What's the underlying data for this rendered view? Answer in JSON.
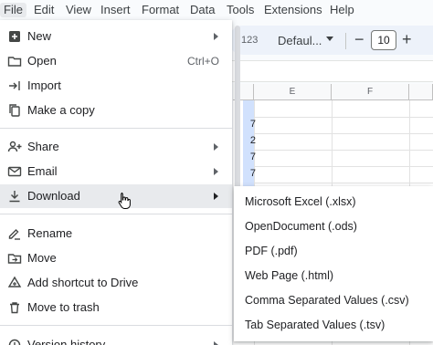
{
  "menubar": {
    "items": [
      "File",
      "Edit",
      "View",
      "Insert",
      "Format",
      "Data",
      "Tools",
      "Extensions",
      "Help"
    ]
  },
  "toolbar": {
    "number_format": "123",
    "font": "Defaul...",
    "minus": "−",
    "font_size": "10",
    "plus": "+"
  },
  "grid": {
    "columns": [
      "E",
      "F"
    ],
    "partial_values": [
      "7",
      "2",
      "7",
      "7"
    ]
  },
  "file_menu": {
    "items": [
      {
        "label": "New",
        "icon": "new-icon",
        "submenu": true
      },
      {
        "label": "Open",
        "icon": "folder-icon",
        "shortcut": "Ctrl+O"
      },
      {
        "label": "Import",
        "icon": "import-icon"
      },
      {
        "label": "Make a copy",
        "icon": "copy-icon"
      },
      {
        "label": "Share",
        "icon": "share-icon",
        "submenu": true
      },
      {
        "label": "Email",
        "icon": "email-icon",
        "submenu": true
      },
      {
        "label": "Download",
        "icon": "download-icon",
        "submenu": true
      },
      {
        "label": "Rename",
        "icon": "rename-icon"
      },
      {
        "label": "Move",
        "icon": "move-icon"
      },
      {
        "label": "Add shortcut to Drive",
        "icon": "drive-shortcut-icon"
      },
      {
        "label": "Move to trash",
        "icon": "trash-icon"
      },
      {
        "label": "Version history",
        "icon": "history-icon",
        "submenu": true
      }
    ]
  },
  "download_submenu": {
    "items": [
      "Microsoft Excel (.xlsx)",
      "OpenDocument (.ods)",
      "PDF (.pdf)",
      "Web Page (.html)",
      "Comma Separated Values (.csv)",
      "Tab Separated Values (.tsv)"
    ]
  },
  "colors": {
    "menu_hover": "#e8eaed",
    "toolbar_bg": "#edf2fa",
    "text": "#202124",
    "selection": "#c6dafc"
  }
}
